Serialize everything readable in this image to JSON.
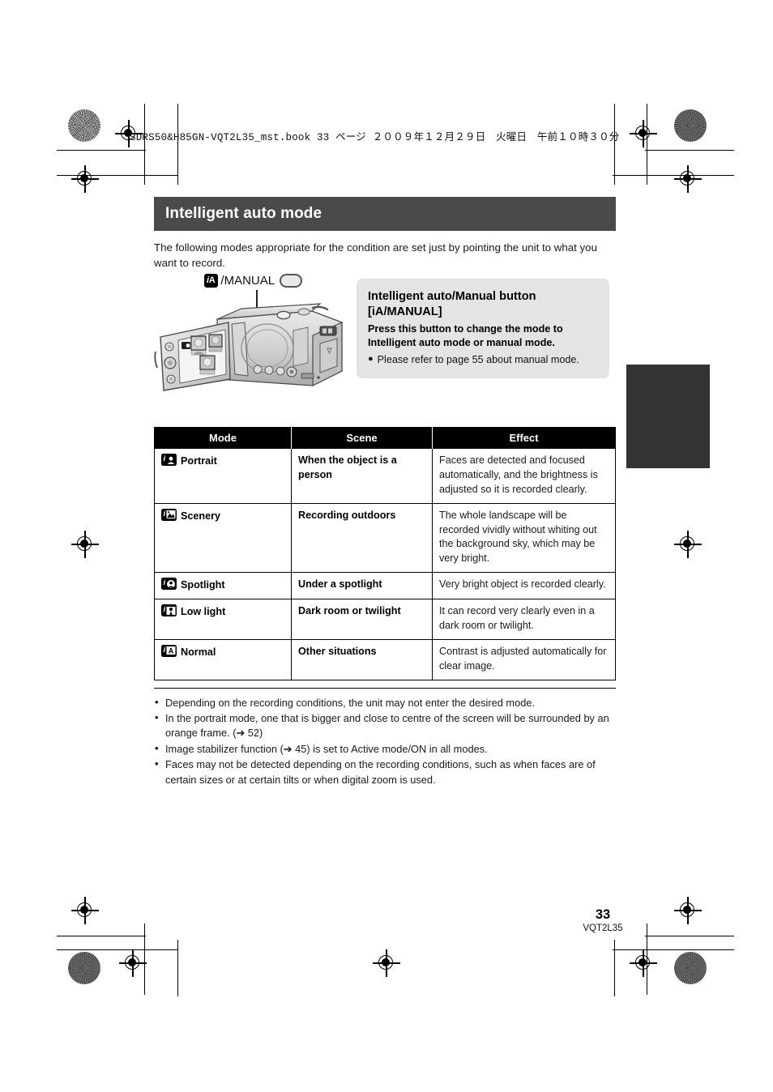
{
  "book_header": "SDRS50&H85GN-VQT2L35_mst.book  33 ページ  ２００９年１２月２９日　火曜日　午前１０時３０分",
  "section": {
    "title": "Intelligent auto mode",
    "intro": "The following modes appropriate for the condition are set just by pointing the unit to what you want to record."
  },
  "figure": {
    "badge_i": "i",
    "badge_a": "A",
    "button_label": "/MANUAL",
    "alt": "camcorder-illustration"
  },
  "callout": {
    "heading_line1": "Intelligent auto/Manual button",
    "heading_line2": "[iA/MANUAL]",
    "body": "Press this button to change the mode to Intelligent auto mode or manual mode.",
    "bullet_mark": "●",
    "note": "Please refer to page 55 about manual mode."
  },
  "table": {
    "headers": [
      "Mode",
      "Scene",
      "Effect"
    ],
    "rows": [
      {
        "icon": "portrait-icon",
        "icon_letter": "i",
        "mode": "Portrait",
        "scene": "When the object is a person",
        "effect": "Faces are detected and focused automatically, and the brightness is adjusted so it is recorded clearly."
      },
      {
        "icon": "scenery-icon",
        "icon_letter": "i",
        "mode": "Scenery",
        "scene": "Recording outdoors",
        "effect": "The whole landscape will be recorded vividly without whiting out the background sky, which may be very bright."
      },
      {
        "icon": "spotlight-icon",
        "icon_letter": "i",
        "mode": "Spotlight",
        "scene": "Under a spotlight",
        "effect": "Very bright object is recorded clearly."
      },
      {
        "icon": "low-light-icon",
        "icon_letter": "i",
        "mode": "Low light",
        "scene": "Dark room or twilight",
        "effect": "It can record very clearly even in a dark room or twilight."
      },
      {
        "icon": "normal-icon",
        "icon_letter": "i",
        "mode": "Normal",
        "scene": "Other situations",
        "effect": "Contrast is adjusted automatically for clear image."
      }
    ]
  },
  "notes": [
    "Depending on the recording conditions, the unit may not enter the desired mode.",
    "In the portrait mode, one that is bigger and close to centre of the screen will be surrounded by an orange frame. (➔ 52)",
    "Image stabilizer function (➔ 45) is set to Active mode/ON in all modes.",
    "Faces may not be detected depending on the recording conditions, such as when faces are of certain sizes or at certain tilts or when digital zoom is used."
  ],
  "footer": {
    "page_number": "33",
    "doc_code": "VQT2L35"
  },
  "colors": {
    "section_bar": "#4a4a4a",
    "callout_bg": "#e4e4e4",
    "thumb_tab": "#333333",
    "table_header_bg": "#000000"
  }
}
